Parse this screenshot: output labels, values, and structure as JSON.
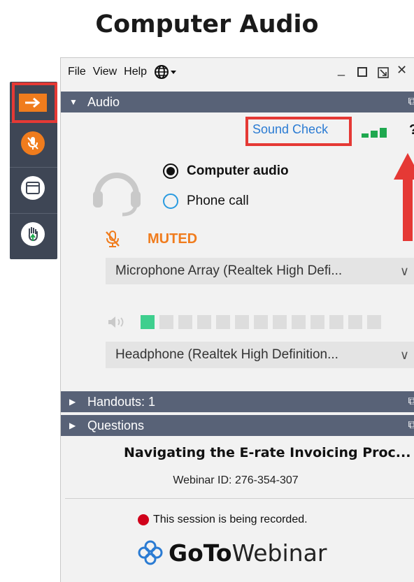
{
  "heading": "Computer Audio",
  "menubar": {
    "file": "File",
    "view": "View",
    "help": "Help"
  },
  "audio_panel": {
    "title": "Audio",
    "sound_check": "Sound Check",
    "help_symbol": "?",
    "options": [
      {
        "label": "Computer audio",
        "selected": true
      },
      {
        "label": "Phone call",
        "selected": false
      }
    ],
    "mic_status": "MUTED",
    "microphone_device": "Microphone Array (Realtek High Defi...",
    "speaker_device": "Headphone (Realtek High Definition...",
    "speaker_level_segments_lit": 1,
    "speaker_level_segments_total": 13,
    "signal_bars_lit": 3
  },
  "handouts_panel": {
    "title": "Handouts: 1"
  },
  "questions_panel": {
    "title": "Questions"
  },
  "footer": {
    "webinar_title": "Navigating the E-rate Invoicing Proc...",
    "webinar_id": "Webinar ID: 276-354-307",
    "recording_notice": "This session is being recorded.",
    "brand_bold": "GoTo",
    "brand_light": "Webinar"
  },
  "colors": {
    "accent_orange": "#f07c1d",
    "highlight_red": "#e53935",
    "panel_header": "#586277",
    "sidebar_bg": "#3e4655",
    "link_blue": "#2a7bd3",
    "signal_green": "#1fa84f",
    "meter_green": "#3ecf8e",
    "record_red": "#d0021b"
  },
  "icons": [
    "arrow-right-icon",
    "mic-muted-icon",
    "window-icon",
    "raise-hand-icon",
    "globe-icon",
    "headset-icon",
    "speaker-icon",
    "gotowebinar-logo-icon"
  ]
}
